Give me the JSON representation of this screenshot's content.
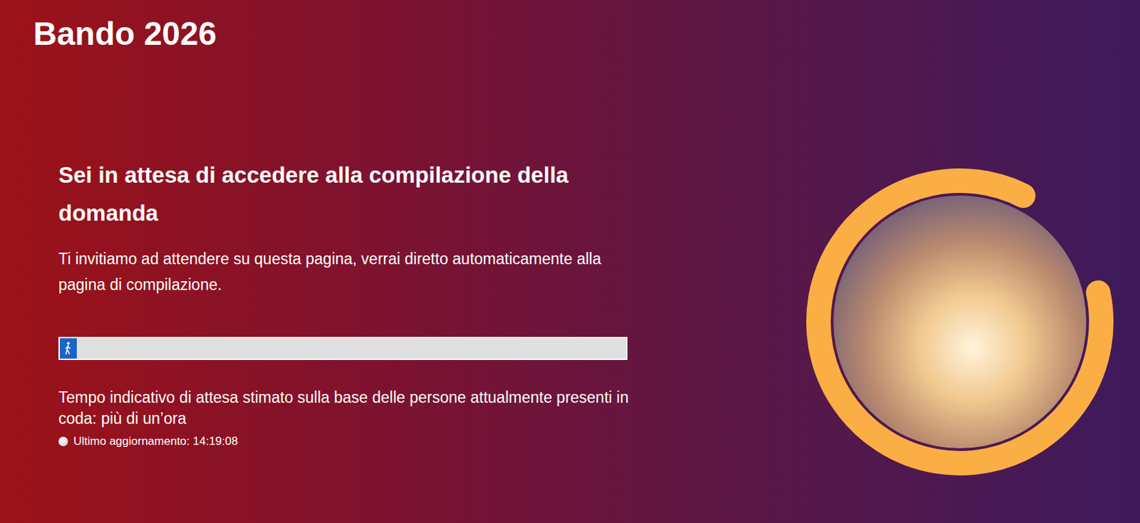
{
  "header": {
    "title": "Bando 2026"
  },
  "queue": {
    "heading": "Sei in attesa di accedere alla compilazione della domanda",
    "message": "Ti invitiamo ad attendere su questa pagina, verrai diretto automaticamente alla pagina di compilazione.",
    "progress": {
      "level": 0.03
    },
    "wait_estimate": "Tempo indicativo di attesa stimato sulla base delle persone attualmente presenti in coda: più di un’ora",
    "last_update": "Ultimo aggiornamento: 14:19:08"
  }
}
